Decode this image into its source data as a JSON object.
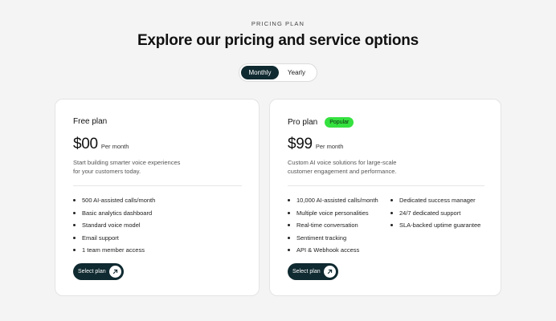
{
  "header": {
    "eyebrow": "PRICING PLAN",
    "title": "Explore our pricing and service options"
  },
  "billing_toggle": {
    "options": [
      "Monthly",
      "Yearly"
    ],
    "selected": "Monthly"
  },
  "plans": [
    {
      "name": "Free plan",
      "badge": "",
      "price": "$00",
      "period": "Per month",
      "description_lines": [
        "Start building smarter voice experiences",
        "for your customers today."
      ],
      "features_col1": [
        "500 AI-assisted calls/month",
        "Basic analytics dashboard",
        "Standard voice model",
        "Email support",
        "1 team member access"
      ],
      "features_col2": [],
      "cta": "Select plan"
    },
    {
      "name": "Pro plan",
      "badge": "Popular",
      "price": "$99",
      "period": "Per month",
      "description_lines": [
        "Custom AI voice solutions for large-scale",
        "customer engagement and performance."
      ],
      "features_col1": [
        "10,000 AI-assisted calls/month",
        "Multiple voice personalities",
        "Real-time conversation",
        "Sentiment tracking",
        "API & Webhook access"
      ],
      "features_col2": [
        "Dedicated success manager",
        "24/7 dedicated support",
        "SLA-backed uptime guarantee"
      ],
      "cta": "Select plan"
    }
  ],
  "colors": {
    "background": "#f4f4f4",
    "primary_dark": "#0f2a30",
    "badge_green": "#35e13f"
  },
  "icons": {
    "cta_icon": "arrow-up-right-icon"
  }
}
